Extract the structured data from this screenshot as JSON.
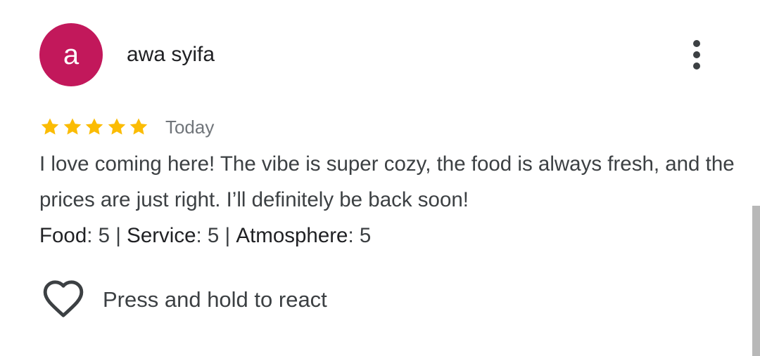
{
  "review": {
    "author": {
      "initial": "a",
      "name": "awa syifa",
      "avatar_color": "#c2185b"
    },
    "more_icon": "more-vertical-icon",
    "rating": 5,
    "rating_max": 5,
    "star_color": "#fbbc04",
    "date": "Today",
    "text": "I love coming here! The vibe is super cozy, the food is always fresh, and the prices are just right. I’ll definitely be back soon!",
    "subratings": {
      "food_label": "Food",
      "food_value": "5",
      "service_label": "Service",
      "service_value": "5",
      "atmosphere_label": "Atmosphere",
      "atmosphere_value": "5",
      "separator": " | "
    },
    "react": {
      "icon": "heart-outline-icon",
      "label": "Press and hold to react"
    }
  }
}
